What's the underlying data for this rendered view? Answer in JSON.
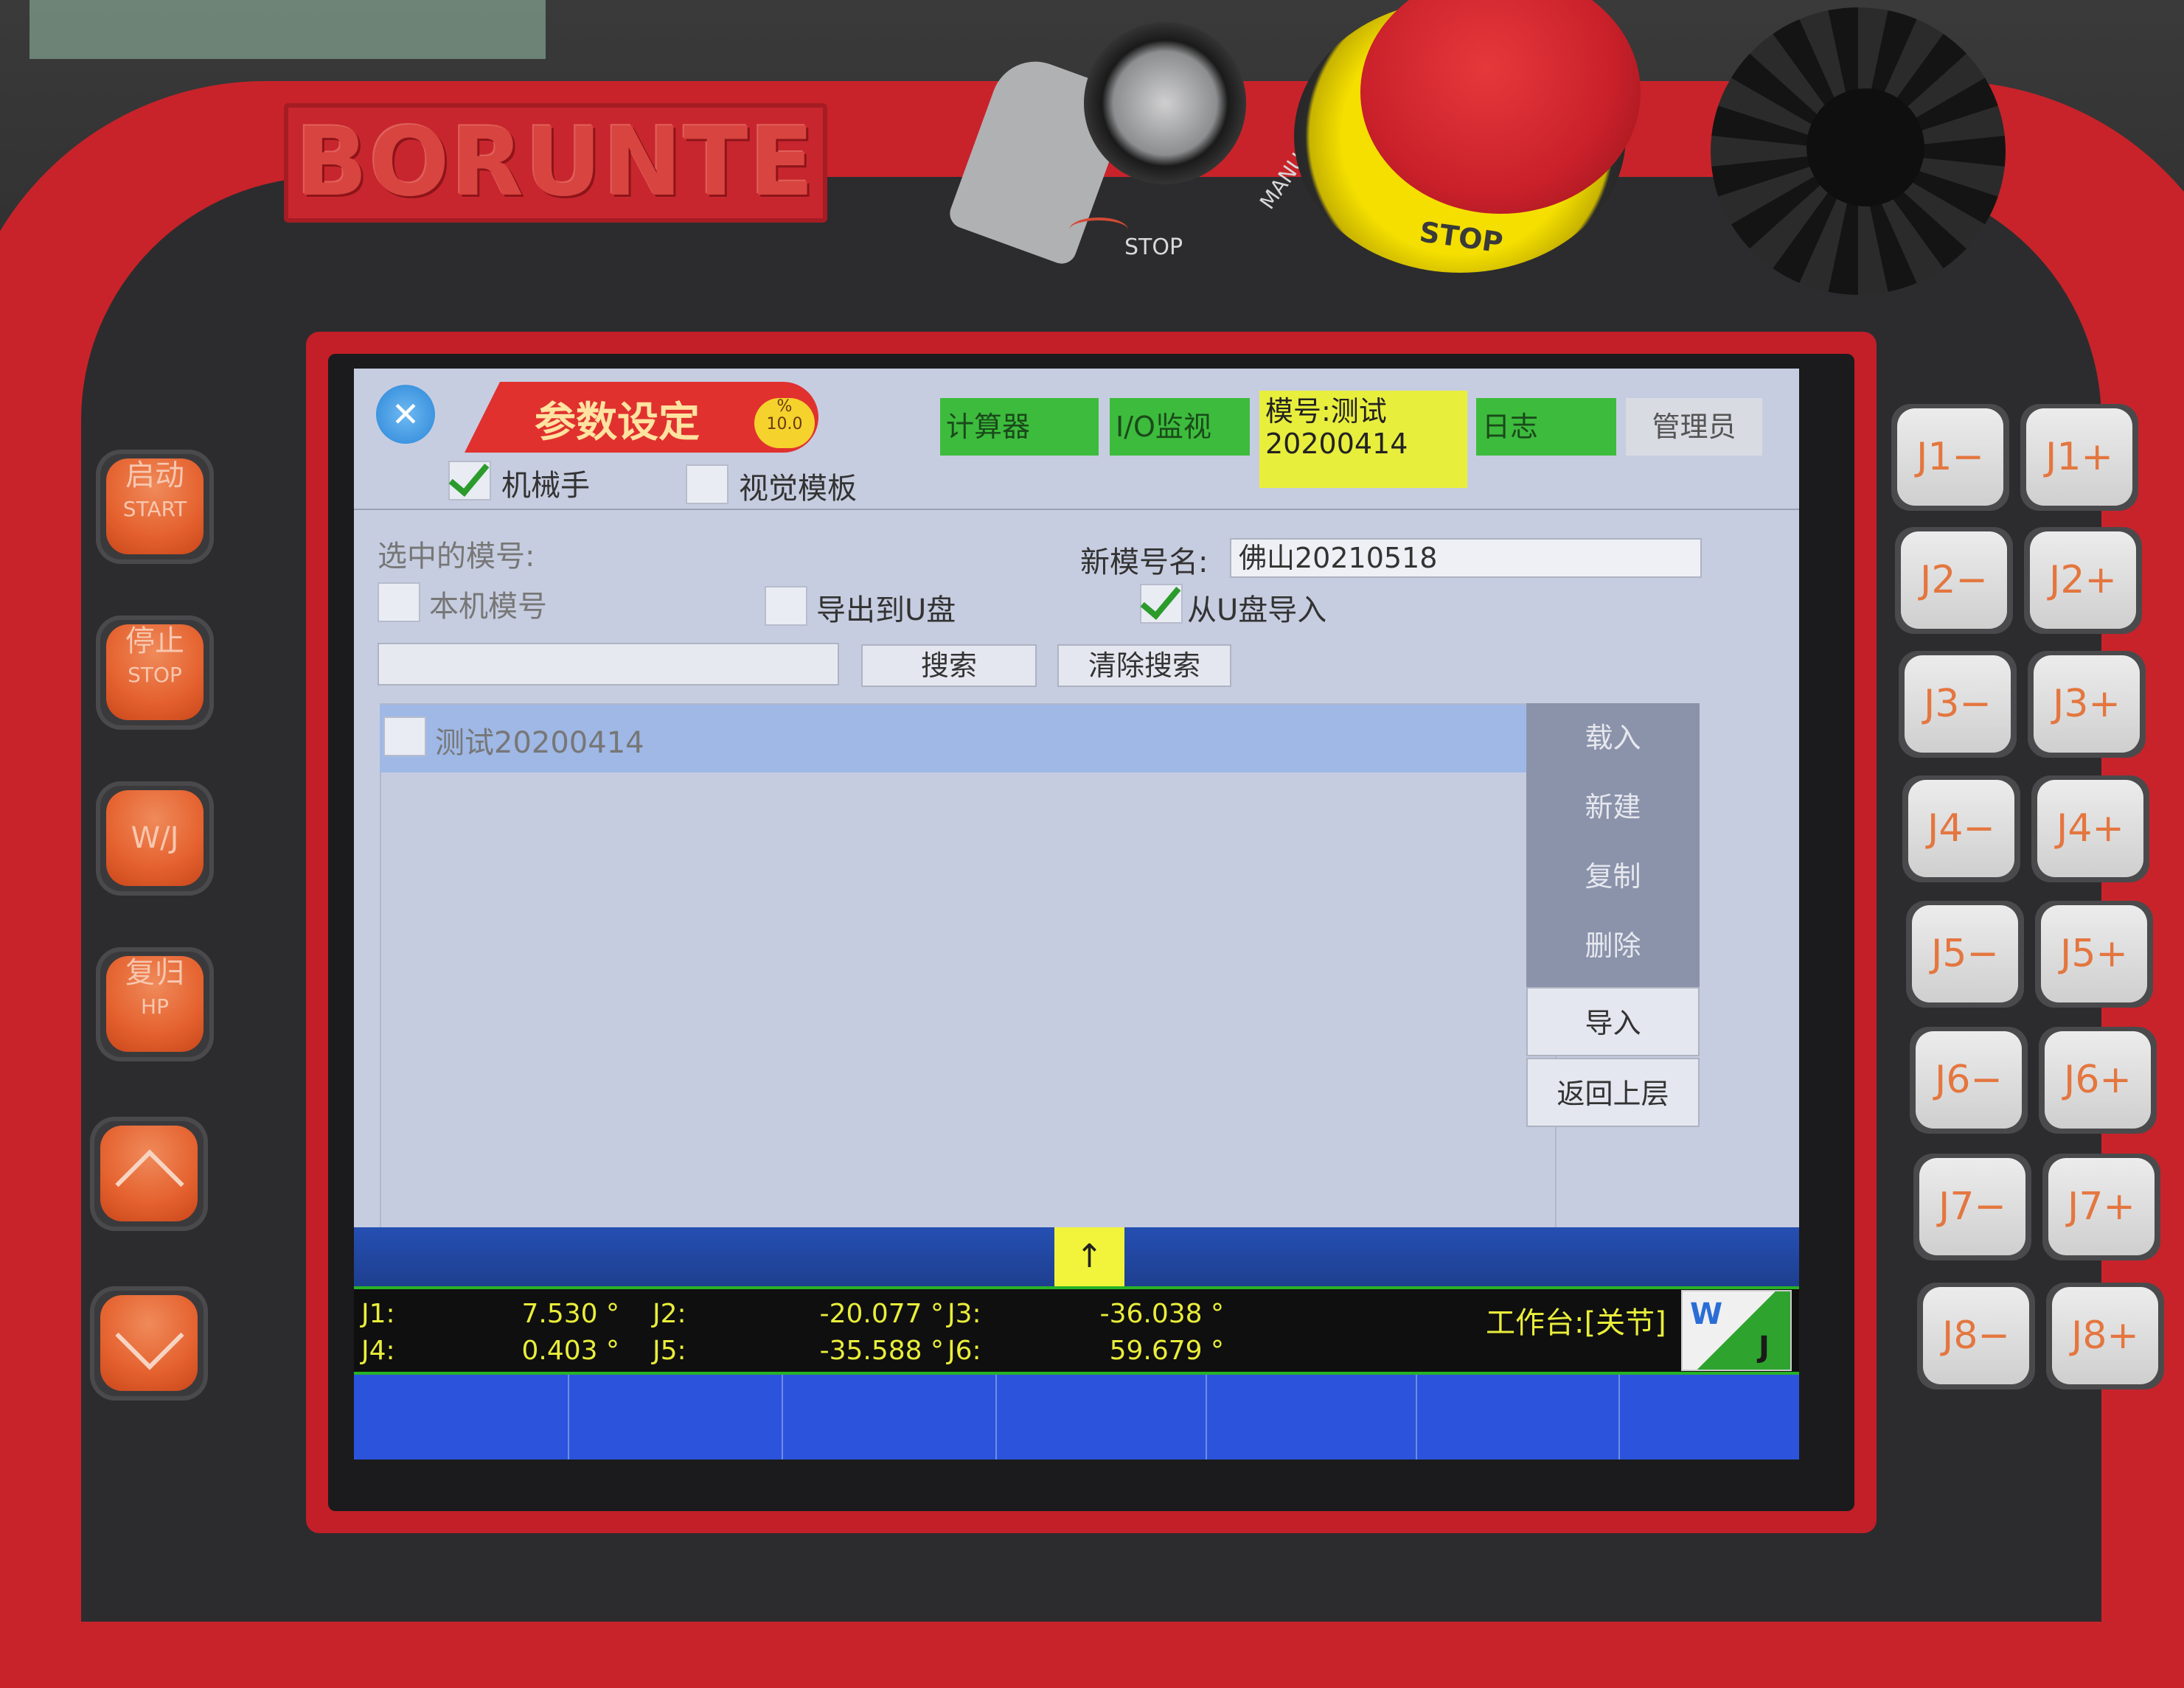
{
  "hardware": {
    "brand_logo": "BORUNTE",
    "key_switch_labels": {
      "stop": "STOP",
      "manual": "MANUAL"
    },
    "estop_label": "STOP",
    "left_buttons": [
      {
        "name": "start",
        "label": "启动",
        "sub": "START"
      },
      {
        "name": "stop",
        "label": "停止",
        "sub": "STOP"
      },
      {
        "name": "wj",
        "label": "W/J",
        "sub": ""
      },
      {
        "name": "home",
        "label": "复归",
        "sub": "HP"
      },
      {
        "name": "up",
        "label": "",
        "sub": ""
      },
      {
        "name": "down",
        "label": "",
        "sub": ""
      }
    ],
    "joint_buttons": [
      [
        "J1−",
        "J1+"
      ],
      [
        "J2−",
        "J2+"
      ],
      [
        "J3−",
        "J3+"
      ],
      [
        "J4−",
        "J4+"
      ],
      [
        "J5−",
        "J5+"
      ],
      [
        "J6−",
        "J6+"
      ],
      [
        "J7−",
        "J7+"
      ],
      [
        "J8−",
        "J8+"
      ]
    ]
  },
  "screen": {
    "title": "参数设定",
    "speed": {
      "symbol": "%",
      "value": "10.0"
    },
    "tabs": {
      "calculator": "计算器",
      "io_monitor": "I/O监视",
      "model_line1": "模号:测试",
      "model_line2": "20200414",
      "log": "日志",
      "admin": "管理员"
    },
    "mode_checks": [
      {
        "label": "机械手",
        "checked": true
      },
      {
        "label": "视觉模板",
        "checked": false
      }
    ],
    "selected_model_label": "选中的模号:",
    "new_model_label": "新模号名:",
    "new_model_value": "佛山20210518",
    "source_checks": [
      {
        "label": "本机模号",
        "checked": false
      },
      {
        "label": "导出到U盘",
        "checked": false
      },
      {
        "label": "从U盘导入",
        "checked": true
      }
    ],
    "search_value": "",
    "search_button": "搜索",
    "clear_search_button": "清除搜索",
    "list_items": [
      {
        "label": "测试20200414",
        "checked": false
      }
    ],
    "side_menu": [
      "载入",
      "新建",
      "复制",
      "删除",
      "导入",
      "返回上层"
    ],
    "nav_arrow": "↑",
    "joints": [
      {
        "label": "J1:",
        "value": "7.530 °"
      },
      {
        "label": "J2:",
        "value": "-20.077 °"
      },
      {
        "label": "J3:",
        "value": "-36.038 °"
      },
      {
        "label": "J4:",
        "value": "0.403 °"
      },
      {
        "label": "J5:",
        "value": "-35.588 °"
      },
      {
        "label": "J6:",
        "value": "59.679 °"
      }
    ],
    "workbench_label": "工作台:[关节]",
    "wj_badge": {
      "w": "W",
      "j": "J"
    }
  },
  "colors": {
    "housing_red": "#c8232a",
    "screen_bg": "#c7cde0",
    "tab_green": "#3dbb3d",
    "tab_yellow": "#e8ee3c",
    "status_text": "#e9ee3a",
    "bottom_blue": "#2c53dc"
  }
}
